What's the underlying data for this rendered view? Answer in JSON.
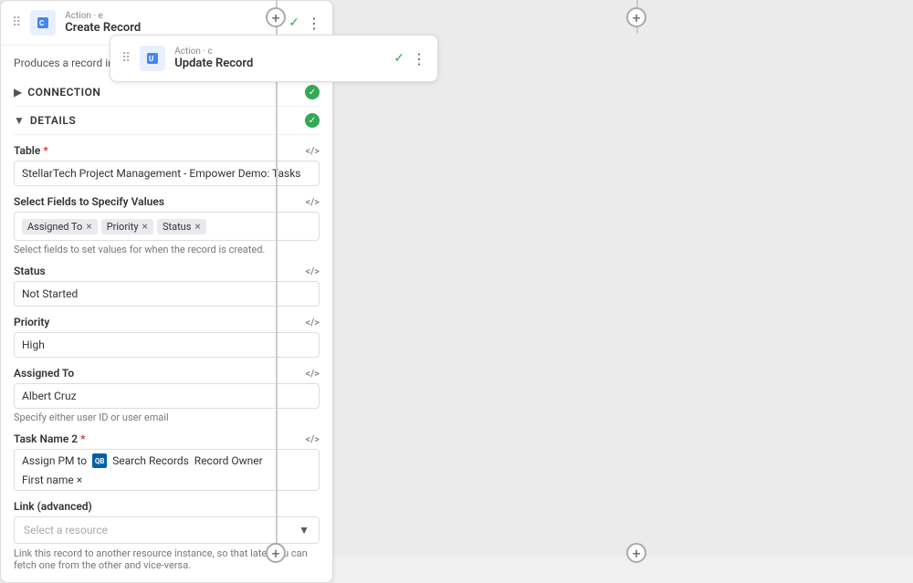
{
  "canvas": {
    "background": "#ebebeb"
  },
  "left_card": {
    "subtitle": "Action · c",
    "title": "Update Record",
    "icon_letter": "U"
  },
  "right_card": {
    "subtitle": "Action · e",
    "title": "Create Record",
    "description": "Produces a record in a Quickbase table based on your criteria.",
    "connection_label": "CONNECTION",
    "details_label": "DETAILS",
    "table_label": "Table",
    "table_required": "*",
    "table_value": "StellarTech Project Management - Empower Demo: Tasks",
    "fields_label": "Select Fields to Specify Values",
    "fields_hint": "Select fields to set values for when the record is created.",
    "fields_tags": [
      "Assigned To",
      "Priority",
      "Status"
    ],
    "status_label": "Status",
    "status_value": "Not Started",
    "priority_label": "Priority",
    "priority_value": "High",
    "assigned_label": "Assigned To",
    "assigned_value": "Albert Cruz",
    "assigned_hint": "Specify either user ID or user email",
    "task_name_label": "Task Name 2",
    "task_name_required": "*",
    "task_name_prefix": "Assign PM to",
    "task_name_pills": [
      "Search Records",
      "Record Owner",
      "First name"
    ],
    "link_label": "Link (advanced)",
    "link_placeholder": "Select a resource",
    "link_hint": "Link this record to another resource instance, so that later you can fetch one from the other and vice-versa."
  },
  "plus_buttons": {
    "label": "+"
  }
}
